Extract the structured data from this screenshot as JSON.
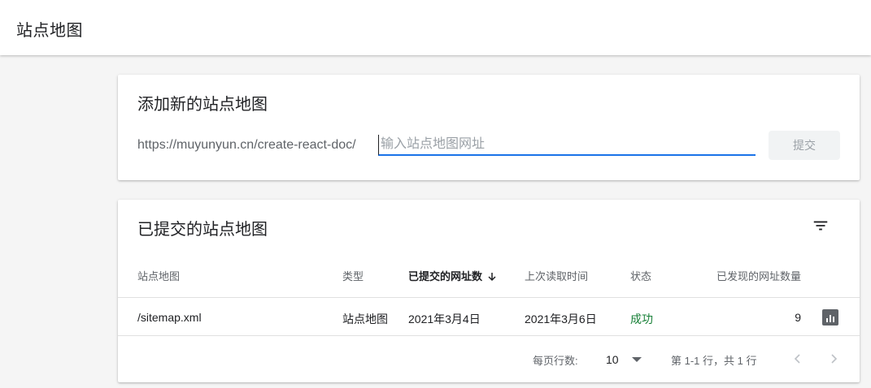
{
  "header": {
    "title": "站点地图"
  },
  "add_card": {
    "title": "添加新的站点地图",
    "url_prefix": "https://muyunyun.cn/create-react-doc/",
    "input_value": "",
    "input_placeholder": "输入站点地图网址",
    "submit_label": "提交"
  },
  "submitted_card": {
    "title": "已提交的站点地图",
    "columns": [
      "站点地图",
      "类型",
      "已提交的网址数",
      "上次读取时间",
      "状态",
      "已发现的网址数量"
    ],
    "rows": [
      {
        "sitemap": "/sitemap.xml",
        "type": "站点地图",
        "submitted": "2021年3月4日",
        "last_read": "2021年3月6日",
        "status": "成功",
        "discovered": "9"
      }
    ],
    "pagination": {
      "rows_per_page_label": "每页行数:",
      "rows_per_page_value": "10",
      "range_text": "第 1-1 行，共 1 行"
    }
  },
  "colors": {
    "accent": "#1a73e8",
    "success": "#188038",
    "muted": "#5f6368"
  },
  "icons": [
    "filter-icon",
    "sort-down-icon",
    "bar-chart-icon",
    "chevron-left-icon",
    "chevron-right-icon",
    "dropdown-arrow-icon"
  ]
}
